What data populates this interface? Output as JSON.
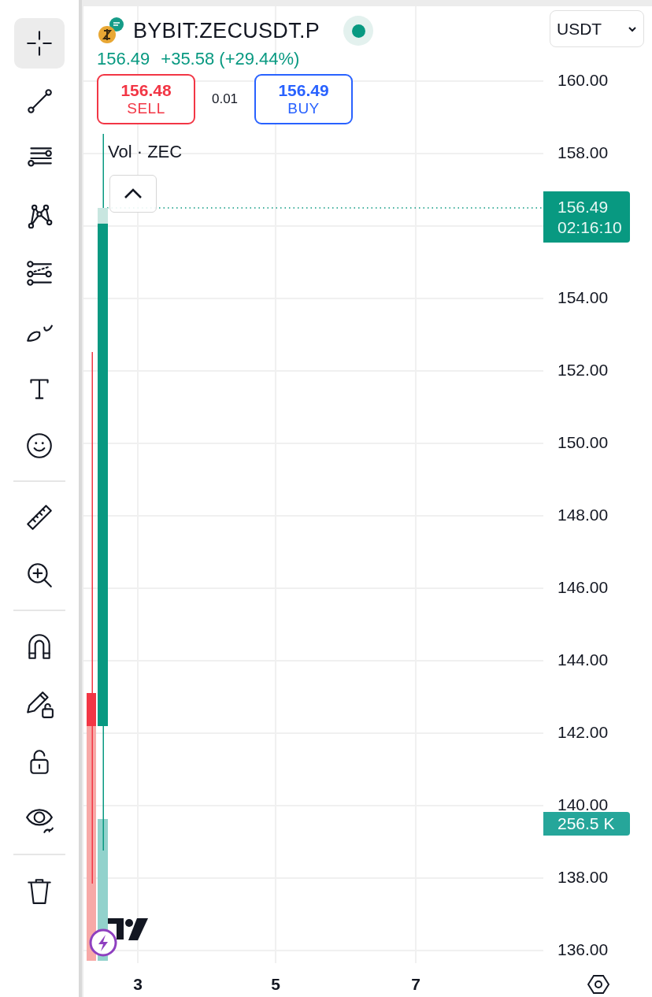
{
  "toolbar": {
    "groups": [
      [
        {
          "kind": "crosshair",
          "selected": true
        },
        {
          "kind": "trend-line",
          "selected": false
        },
        {
          "kind": "fib",
          "selected": false
        },
        {
          "kind": "pattern",
          "selected": false
        },
        {
          "kind": "projection",
          "selected": false
        },
        {
          "kind": "brush",
          "selected": false
        },
        {
          "kind": "text",
          "selected": false
        },
        {
          "kind": "emoji",
          "selected": false
        }
      ],
      [
        {
          "kind": "ruler",
          "selected": false
        },
        {
          "kind": "zoom",
          "selected": false
        }
      ],
      [
        {
          "kind": "magnet",
          "selected": false
        },
        {
          "kind": "lock-drawing",
          "selected": false
        },
        {
          "kind": "lock",
          "selected": false
        },
        {
          "kind": "eye",
          "selected": false
        }
      ],
      [
        {
          "kind": "trash",
          "selected": false
        }
      ]
    ]
  },
  "symbol": {
    "title": "BYBIT:ZECUSDT.P",
    "market_open": true
  },
  "quote": {
    "rising": true,
    "last": "156.49",
    "change": "+35.58 (+29.44%)"
  },
  "sell": {
    "price": "156.48",
    "label": "SELL"
  },
  "spread": "0.01",
  "buy": {
    "price": "156.49",
    "label": "BUY"
  },
  "indicator": "Vol · ZEC",
  "currency": "USDT",
  "price_axis_upper": [
    "160.00",
    "158.00"
  ],
  "price_axis_lower": [
    "154.00",
    "152.00",
    "150.00",
    "148.00",
    "146.00",
    "144.00",
    "142.00",
    "140.00",
    "138.00",
    "136.00"
  ],
  "last_price_label": {
    "price": "156.49",
    "countdown": "02:16:10"
  },
  "volume_label": "256.5 K",
  "time_axis": [
    "3",
    "5",
    "7"
  ]
}
